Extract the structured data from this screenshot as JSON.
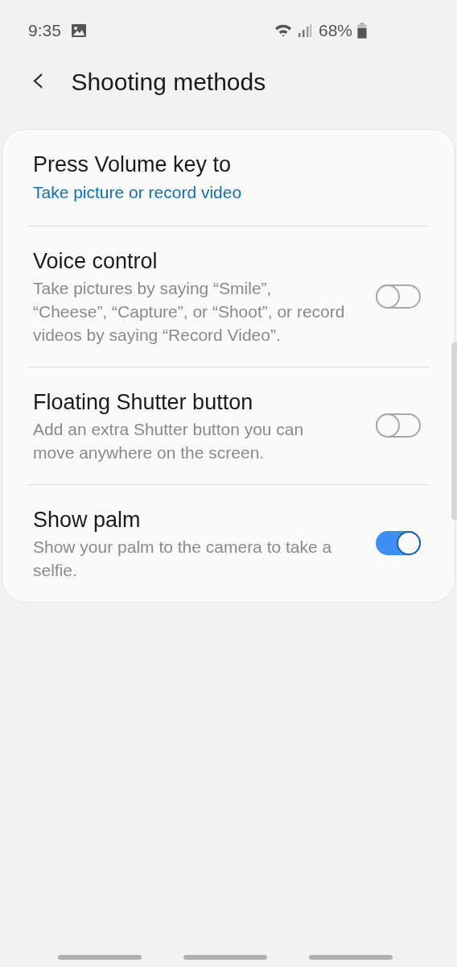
{
  "status_bar": {
    "time": "9:35",
    "battery": "68%"
  },
  "header": {
    "back": "‹",
    "title": "Shooting methods"
  },
  "items": [
    {
      "kind": "value",
      "title": "Press Volume key to",
      "value": "Take picture or record video"
    },
    {
      "kind": "switch",
      "title": "Voice control",
      "description": "Take pictures by saying “Smile”, “Cheese”, “Capture”, or “Shoot”, or record videos by saying “Record Video”.",
      "on": false
    },
    {
      "kind": "switch",
      "title": "Floating Shutter button",
      "description": "Add an extra Shutter button you can move anywhere on the screen.",
      "on": false
    },
    {
      "kind": "switch",
      "title": "Show palm",
      "description": "Show your palm to the camera to take a selfie.",
      "on": true
    }
  ]
}
